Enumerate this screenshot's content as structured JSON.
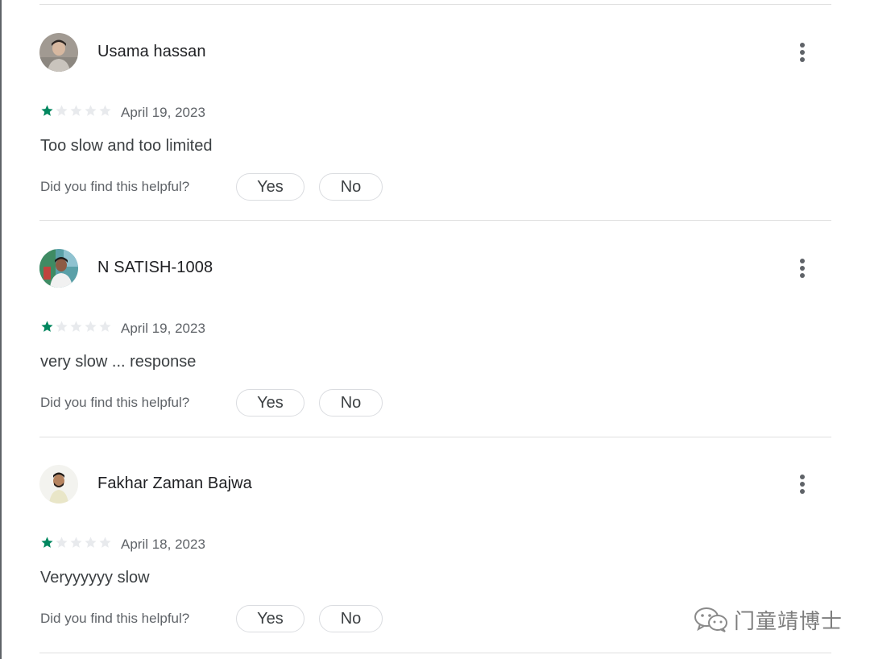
{
  "reviews": [
    {
      "author": "Usama hassan",
      "rating": 1,
      "max_rating": 5,
      "date": "April 19, 2023",
      "text": "Too slow and too limited",
      "helpful_prompt": "Did you find this helpful?",
      "yes_label": "Yes",
      "no_label": "No"
    },
    {
      "author": "N SATISH-1008",
      "rating": 1,
      "max_rating": 5,
      "date": "April 19, 2023",
      "text": "very slow ... response",
      "helpful_prompt": "Did you find this helpful?",
      "yes_label": "Yes",
      "no_label": "No"
    },
    {
      "author": "Fakhar Zaman Bajwa",
      "rating": 1,
      "max_rating": 5,
      "date": "April 18, 2023",
      "text": "Veryyyyyy slow",
      "helpful_prompt": "Did you find this helpful?",
      "yes_label": "Yes",
      "no_label": "No"
    }
  ],
  "watermark": {
    "icon": "wechat-icon",
    "text": "门童靖博士"
  },
  "colors": {
    "star_filled": "#01875f",
    "star_empty": "#e8eaed",
    "divider": "#e0e0e0",
    "muted_text": "#5f6368"
  },
  "icons": {
    "more": "more-vert-icon",
    "star": "star-icon"
  }
}
